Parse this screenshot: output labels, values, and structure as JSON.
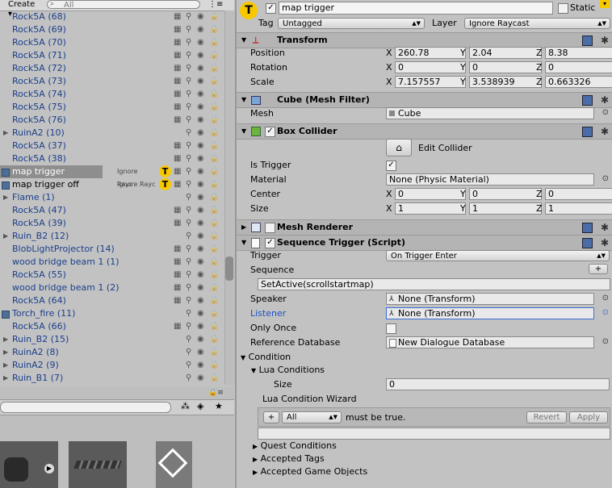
{
  "hierarchy": {
    "create_label": "Create",
    "search_placeholder": "All",
    "ignore_label": "Ignore Rayc",
    "t_badge": "T",
    "rows": [
      {
        "label": "Rock5A (68)"
      },
      {
        "label": "Rock5A (69)"
      },
      {
        "label": "Rock5A (70)"
      },
      {
        "label": "Rock5A (71)"
      },
      {
        "label": "Rock5A (72)"
      },
      {
        "label": "Rock5A (73)"
      },
      {
        "label": "Rock5A (74)"
      },
      {
        "label": "Rock5A (75)"
      },
      {
        "label": "Rock5A (76)"
      },
      {
        "label": "RuinA2 (10)"
      },
      {
        "label": "Rock5A (37)"
      },
      {
        "label": "Rock5A (38)"
      },
      {
        "label": "map trigger"
      },
      {
        "label": "map trigger off"
      },
      {
        "label": "Flame (1)"
      },
      {
        "label": "Rock5A (47)"
      },
      {
        "label": "Rock5A (39)"
      },
      {
        "label": "Ruin_B2 (12)"
      },
      {
        "label": "BlobLightProjector (14)"
      },
      {
        "label": "wood bridge beam 1 (1)"
      },
      {
        "label": "Rock5A (55)"
      },
      {
        "label": "wood bridge beam 1 (2)"
      },
      {
        "label": "Rock5A (64)"
      },
      {
        "label": "Torch_fire (11)"
      },
      {
        "label": "Rock5A (66)"
      },
      {
        "label": "Ruin_B2 (15)"
      },
      {
        "label": "RuinA2 (8)"
      },
      {
        "label": "RuinA2 (9)"
      },
      {
        "label": "Ruin_B1 (7)"
      }
    ]
  },
  "inspector": {
    "object_name": "map trigger",
    "static_label": "Static",
    "tag_label": "Tag",
    "tag_value": "Untagged",
    "layer_label": "Layer",
    "layer_value": "Ignore Raycast",
    "transform": {
      "title": "Transform",
      "position_label": "Position",
      "rotation_label": "Rotation",
      "scale_label": "Scale",
      "axis_x": "X",
      "axis_y": "Y",
      "axis_z": "Z",
      "position": [
        "260.78",
        "2.04",
        "8.38"
      ],
      "rotation": [
        "0",
        "0",
        "0"
      ],
      "scale": [
        "7.157557",
        "3.538939",
        "0.663326"
      ]
    },
    "mesh_filter": {
      "title": "Cube (Mesh Filter)",
      "mesh_label": "Mesh",
      "mesh_value": "Cube"
    },
    "box_collider": {
      "title": "Box Collider",
      "edit_label": "Edit Collider",
      "is_trigger_label": "Is Trigger",
      "material_label": "Material",
      "material_value": "None (Physic Material)",
      "center_label": "Center",
      "size_label": "Size",
      "center": [
        "0",
        "0",
        "0"
      ],
      "size": [
        "1",
        "1",
        "1"
      ]
    },
    "mesh_renderer": {
      "title": "Mesh Renderer"
    },
    "sequence_trigger": {
      "title": "Sequence Trigger (Script)",
      "trigger_label": "Trigger",
      "trigger_value": "On Trigger Enter",
      "sequence_label": "Sequence",
      "plus": "+",
      "sequence_value": "SetActive(scrollstartmap)",
      "speaker_label": "Speaker",
      "speaker_value": "None (Transform)",
      "listener_label": "Listener",
      "listener_value": "None (Transform)",
      "only_once_label": "Only Once",
      "ref_db_label": "Reference Database",
      "ref_db_value": "New Dialogue Database",
      "condition_label": "Condition",
      "lua_conditions_label": "Lua Conditions",
      "size_label": "Size",
      "size_value": "0",
      "lua_wizard_label": "Lua Condition Wizard",
      "wizard_plus": "+",
      "wizard_mode": "All",
      "must_be_true": "must be true.",
      "revert_label": "Revert",
      "apply_label": "Apply",
      "quest_conditions": "Quest Conditions",
      "accepted_tags": "Accepted Tags",
      "accepted_game_objects": "Accepted Game Objects"
    }
  }
}
